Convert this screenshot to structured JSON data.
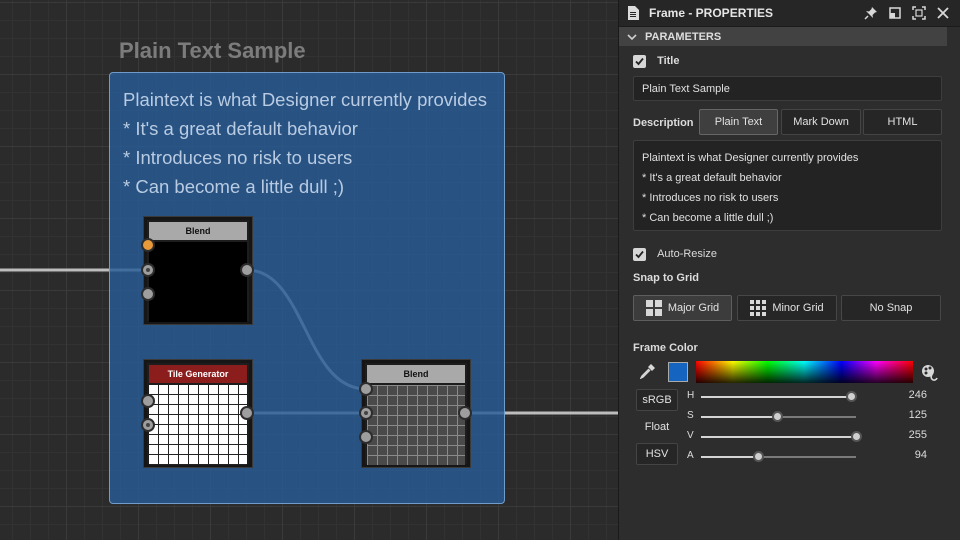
{
  "frame": {
    "title": "Plain Text Sample",
    "description_lines": [
      "Plaintext is what Designer currently provides",
      "* It's a great default behavior",
      "* Introduces no risk to users",
      "* Can become a little dull ;)"
    ],
    "fill_color": "#275c96"
  },
  "nodes": {
    "blend_1": {
      "label": "Blend"
    },
    "tile_generator": {
      "label": "Tile Generator"
    },
    "blend_2": {
      "label": "Blend"
    }
  },
  "panel": {
    "title": "Frame - PROPERTIES",
    "icons": [
      "document-icon",
      "pin-icon",
      "restore-icon",
      "maximize-icon",
      "close-icon"
    ],
    "section": "PARAMETERS",
    "title_checkbox": {
      "label": "Title",
      "checked": true
    },
    "title_value": "Plain Text Sample",
    "description_label": "Description",
    "description_modes": [
      "Plain Text",
      "Mark Down",
      "HTML"
    ],
    "description_active_mode": "Plain Text",
    "description_lines": [
      "Plaintext is what Designer currently provides",
      "* It's a great default behavior",
      "* Introduces no risk to users",
      "* Can become a little dull ;)"
    ],
    "auto_resize": {
      "label": "Auto-Resize",
      "checked": true
    },
    "snap_label": "Snap to Grid",
    "snap_options": [
      "Major Grid",
      "Minor Grid",
      "No Snap"
    ],
    "snap_active": "Major Grid",
    "frame_color_label": "Frame Color",
    "frame_color_swatch": "#1565c0",
    "color_modes": [
      "sRGB",
      "Float",
      "HSV"
    ],
    "sliders": [
      {
        "label": "H",
        "value": 246,
        "max": 255
      },
      {
        "label": "S",
        "value": 125,
        "max": 255
      },
      {
        "label": "V",
        "value": 255,
        "max": 255
      },
      {
        "label": "A",
        "value": 94,
        "max": 255
      }
    ]
  }
}
